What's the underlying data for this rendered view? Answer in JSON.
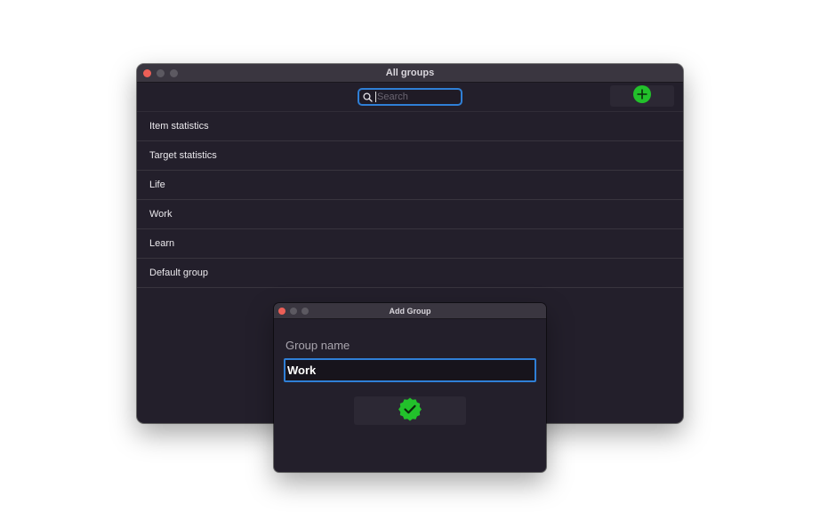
{
  "main_window": {
    "title": "All groups",
    "search": {
      "placeholder": "Search",
      "value": ""
    },
    "add_button_icon": "plus-circle-icon",
    "groups": [
      {
        "label": "Item statistics"
      },
      {
        "label": "Target statistics"
      },
      {
        "label": "Life"
      },
      {
        "label": "Work"
      },
      {
        "label": "Learn"
      },
      {
        "label": "Default group"
      }
    ]
  },
  "dialog": {
    "title": "Add Group",
    "field_label": "Group name",
    "field_value": "Work",
    "confirm_icon": "checkmark-seal-icon"
  },
  "colors": {
    "accent": "#2f7fd6",
    "green": "#22c12b",
    "close_red": "#ec5f57"
  }
}
